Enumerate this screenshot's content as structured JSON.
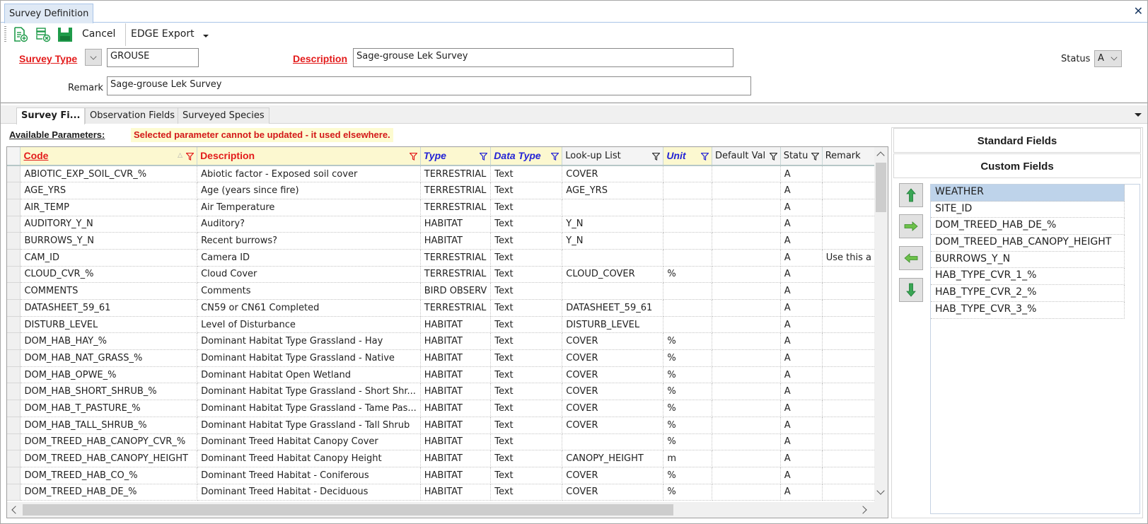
{
  "window": {
    "doc_tab_title": "Survey Definition",
    "close_icon": "close-x-icon"
  },
  "toolbar": {
    "icons": [
      "new-record-icon",
      "delete-record-icon",
      "save-icon"
    ],
    "cancel_label": "Cancel",
    "export_label": "EDGE Export",
    "export_dropdown_icon": "dropdown-arrow-icon"
  },
  "form": {
    "survey_type_label": "Survey Type",
    "survey_type_value": "GROUSE",
    "description_label": "Description",
    "description_value": "Sage-grouse Lek Survey",
    "remark_label": "Remark",
    "remark_value": "Sage-grouse Lek Survey",
    "status_label": "Status",
    "status_value": "A"
  },
  "tabs": [
    {
      "label": "Survey Fi...",
      "active": true
    },
    {
      "label": "Observation Fields",
      "active": false
    },
    {
      "label": "Surveyed Species",
      "active": false
    }
  ],
  "available": {
    "label": "Available Parameters:",
    "warning": "Selected parameter cannot be updated - it used elsewhere."
  },
  "grid": {
    "columns": [
      {
        "label": "Code",
        "style": "red-underline",
        "sorted": "asc",
        "filter_color": "#e31b1b"
      },
      {
        "label": "Description",
        "style": "red",
        "filter_color": "#e31b1b"
      },
      {
        "label": "Type",
        "style": "blue",
        "filter_color": "#2323d6"
      },
      {
        "label": "Data Type",
        "style": "blue",
        "filter_color": "#2323d6"
      },
      {
        "label": "Look-up List",
        "style": "plain",
        "filter_color": "#333333"
      },
      {
        "label": "Unit",
        "style": "blue",
        "filter_color": "#2323d6"
      },
      {
        "label": "Default Val",
        "style": "plain",
        "filter_color": "#333333"
      },
      {
        "label": "Statu",
        "style": "plain",
        "filter_color": "#333333"
      },
      {
        "label": "Remark",
        "style": "plain"
      }
    ],
    "rows": [
      [
        "ABIOTIC_EXP_SOIL_CVR_%",
        "Abiotic factor - Exposed soil cover",
        "TERRESTRIAL",
        "Text",
        "COVER",
        "",
        "",
        "A",
        ""
      ],
      [
        "AGE_YRS",
        "Age (years since fire)",
        "TERRESTRIAL",
        "Text",
        "AGE_YRS",
        "",
        "",
        "A",
        ""
      ],
      [
        "AIR_TEMP",
        "Air Temperature",
        "TERRESTRIAL",
        "Text",
        "",
        "",
        "",
        "A",
        ""
      ],
      [
        "AUDITORY_Y_N",
        "Auditory?",
        "HABITAT",
        "Text",
        "Y_N",
        "",
        "",
        "A",
        ""
      ],
      [
        "BURROWS_Y_N",
        "Recent burrows?",
        "HABITAT",
        "Text",
        "Y_N",
        "",
        "",
        "A",
        ""
      ],
      [
        "CAM_ID",
        "Camera ID",
        "TERRESTRIAL",
        "Text",
        "",
        "",
        "",
        "A",
        "Use this a"
      ],
      [
        "CLOUD_CVR_%",
        "Cloud Cover",
        "TERRESTRIAL",
        "Text",
        "CLOUD_COVER",
        "%",
        "",
        "A",
        ""
      ],
      [
        "COMMENTS",
        "Comments",
        "BIRD OBSERV",
        "Text",
        "",
        "",
        "",
        "A",
        ""
      ],
      [
        "DATASHEET_59_61",
        "CN59 or CN61 Completed",
        "TERRESTRIAL",
        "Text",
        "DATASHEET_59_61",
        "",
        "",
        "A",
        ""
      ],
      [
        "DISTURB_LEVEL",
        "Level of Disturbance",
        "HABITAT",
        "Text",
        "DISTURB_LEVEL",
        "",
        "",
        "A",
        ""
      ],
      [
        "DOM_HAB_HAY_%",
        "Dominant Habitat Type Grassland - Hay",
        "HABITAT",
        "Text",
        "COVER",
        "%",
        "",
        "A",
        ""
      ],
      [
        "DOM_HAB_NAT_GRASS_%",
        "Dominant Habitat Type Grassland - Native",
        "HABITAT",
        "Text",
        "COVER",
        "%",
        "",
        "A",
        ""
      ],
      [
        "DOM_HAB_OPWE_%",
        "Dominant Habitat Open Wetland",
        "HABITAT",
        "Text",
        "COVER",
        "%",
        "",
        "A",
        ""
      ],
      [
        "DOM_HAB_SHORT_SHRUB_%",
        "Dominant Habitat Type Grassland - Short Shr...",
        "HABITAT",
        "Text",
        "COVER",
        "%",
        "",
        "A",
        ""
      ],
      [
        "DOM_HAB_T_PASTURE_%",
        "Dominant Habitat Type Grassland - Tame Pas...",
        "HABITAT",
        "Text",
        "COVER",
        "%",
        "",
        "A",
        ""
      ],
      [
        "DOM_HAB_TALL_SHRUB_%",
        "Dominant Habitat Type Grassland - Tall Shrub",
        "HABITAT",
        "Text",
        "COVER",
        "%",
        "",
        "A",
        ""
      ],
      [
        "DOM_TREED_HAB_CANOPY_CVR_%",
        "Dominant Treed Habitat Canopy Cover",
        "HABITAT",
        "Text",
        "",
        "%",
        "",
        "A",
        ""
      ],
      [
        "DOM_TREED_HAB_CANOPY_HEIGHT",
        "Dominant Treed Habitat Canopy Height",
        "HABITAT",
        "Text",
        "CANOPY_HEIGHT",
        "m",
        "",
        "A",
        ""
      ],
      [
        "DOM_TREED_HAB_CO_%",
        "Dominant Treed Habitat - Coniferous",
        "HABITAT",
        "Text",
        "COVER",
        "%",
        "",
        "A",
        ""
      ],
      [
        "DOM_TREED_HAB_DE_%",
        "Dominant Treed Habitat - Deciduous",
        "HABITAT",
        "Text",
        "COVER",
        "%",
        "",
        "A",
        ""
      ]
    ]
  },
  "right_panel": {
    "standard_fields_label": "Standard Fields",
    "custom_fields_label": "Custom Fields",
    "buttons": [
      "move-up-icon",
      "move-right-icon",
      "move-left-icon",
      "move-down-icon"
    ],
    "fields": [
      "WEATHER",
      "SITE_ID",
      "DOM_TREED_HAB_DE_%",
      "DOM_TREED_HAB_CANOPY_HEIGHT",
      "BURROWS_Y_N",
      "HAB_TYPE_CVR_1_%",
      "HAB_TYPE_CVR_2_%",
      "HAB_TYPE_CVR_3_%"
    ],
    "selected_index": 0
  },
  "colors": {
    "required_label": "#e31b1b",
    "blue_header": "#2323d6",
    "icon_green": "#1f9b4a",
    "selection": "#bed3ea",
    "warning_bg": "#fdfbd0"
  }
}
